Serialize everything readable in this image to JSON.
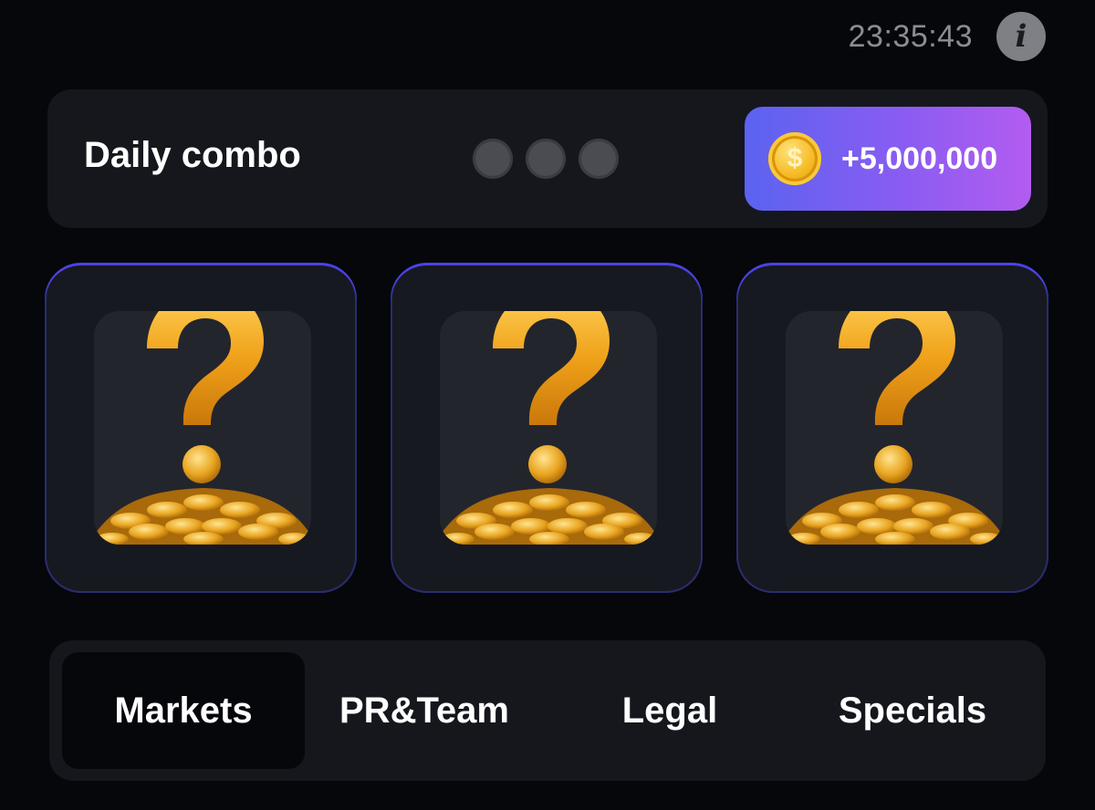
{
  "header": {
    "timer": "23:35:43",
    "info_icon": "info-icon"
  },
  "combo": {
    "title": "Daily combo",
    "dots_found": 0,
    "dots_total": 3,
    "reward": "+5,000,000",
    "coin_icon": "dollar-coin-icon",
    "reward_symbol": "$"
  },
  "cards": [
    {
      "icon": "question-mark-coins-icon"
    },
    {
      "icon": "question-mark-coins-icon"
    },
    {
      "icon": "question-mark-coins-icon"
    }
  ],
  "tabs": {
    "markets": "Markets",
    "pr_team": "PR&Team",
    "legal": "Legal",
    "specials": "Specials",
    "active": "Markets"
  },
  "colors": {
    "background": "#05070b",
    "panel": "#15171d",
    "card_border": "#4b42e6",
    "reward_gradient_start": "#5b63f0",
    "reward_gradient_end": "#b35cf0",
    "gold": "#f5b820"
  }
}
